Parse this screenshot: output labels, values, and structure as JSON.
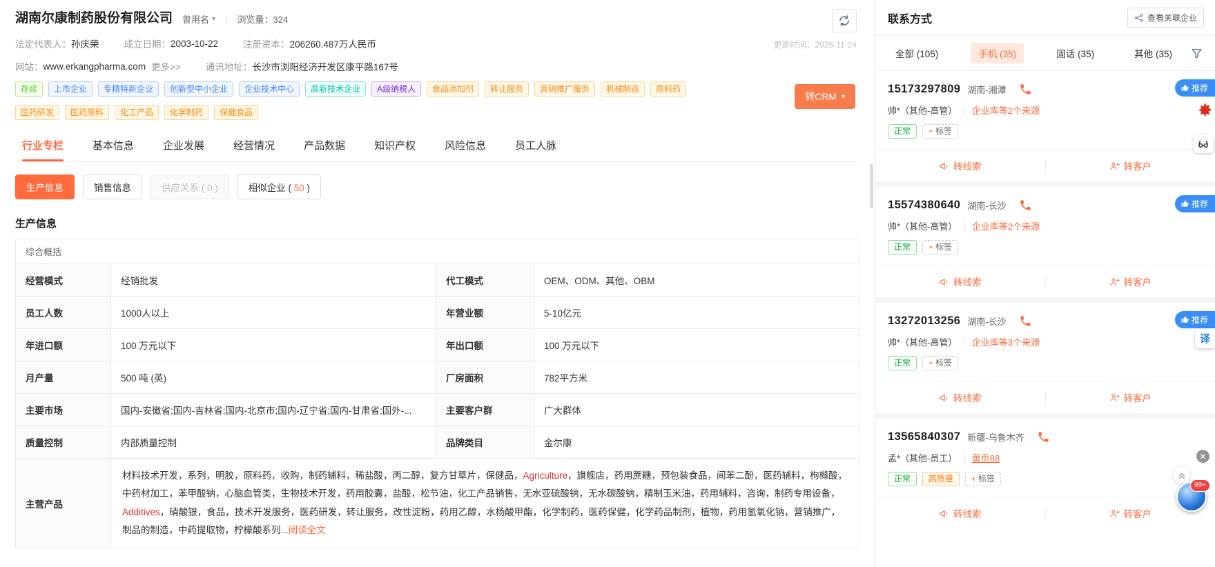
{
  "colors": {
    "accent_orange": "#ff6a3c",
    "crm_button_orange": "#f87c4b",
    "badge_blue": "#3a8ff7",
    "tag_green": "#52c41a",
    "tag_blue": "#3d7fff",
    "tag_teal": "#00b8a9",
    "tag_purple": "#722ed1",
    "tag_orange": "#fa8c16",
    "status_green": "#00b42a",
    "quality_orange": "#ff7d00",
    "highlight_red": "#e03131"
  },
  "header": {
    "company_name": "湖南尔康制药股份有限公司",
    "former_name_label": "曾用名",
    "views_label": "浏览量：",
    "views_count": "324",
    "update_time": "更新时间：2025-11-24",
    "fields": [
      {
        "label": "法定代表人：",
        "value": "孙庆荣"
      },
      {
        "label": "成立日期：",
        "value": "2003-10-22"
      },
      {
        "label": "注册资本：",
        "value": "206260.487万人民币"
      }
    ],
    "website_label": "网站：",
    "website_value": "www.erkangpharma.com",
    "more_link": "更多>>",
    "address_label": "通讯地址：",
    "address_value": "长沙市浏阳经济开发区康平路167号",
    "crm_label": "转CRM",
    "tags_row1": [
      {
        "text": "存续",
        "type": "green"
      },
      {
        "text": "上市企业",
        "type": "blue"
      },
      {
        "text": "专精特新企业",
        "type": "blue"
      },
      {
        "text": "创新型中小企业",
        "type": "blue"
      },
      {
        "text": "企业技术中心",
        "type": "blue"
      },
      {
        "text": "高新技术企业",
        "type": "teal"
      },
      {
        "text": "A级纳税人",
        "type": "purple"
      },
      {
        "text": "食品添加剂",
        "type": "orange"
      },
      {
        "text": "转让服务",
        "type": "orange"
      },
      {
        "text": "营销推广服务",
        "type": "orange"
      },
      {
        "text": "机械制造",
        "type": "orange"
      },
      {
        "text": "原料药",
        "type": "orange"
      }
    ],
    "tags_row2": [
      {
        "text": "医药研发",
        "type": "orange"
      },
      {
        "text": "医药原料",
        "type": "orange"
      },
      {
        "text": "化工产品",
        "type": "orange"
      },
      {
        "text": "化学制药",
        "type": "orange"
      },
      {
        "text": "保健食品",
        "type": "orange"
      }
    ]
  },
  "tabs": {
    "items": [
      "行业专栏",
      "基本信息",
      "企业发展",
      "经营情况",
      "产品数据",
      "知识产权",
      "风险信息",
      "员工人脉"
    ],
    "active_index": 0
  },
  "subtabs": [
    {
      "label": "生产信息",
      "state": "active"
    },
    {
      "label": "销售信息",
      "state": "normal"
    },
    {
      "label": "供应关系 ( 0 )",
      "state": "disabled"
    },
    {
      "prefix": "相似企业 ( ",
      "count": "50",
      "suffix": " )",
      "state": "normal"
    }
  ],
  "production": {
    "section_title": "生产信息",
    "table_header": "综合概括",
    "rows": [
      [
        {
          "label": "经营模式",
          "value": "经销批发"
        },
        {
          "label": "代工模式",
          "value": "OEM、ODM、其他、OBM"
        }
      ],
      [
        {
          "label": "员工人数",
          "value": "1000人以上"
        },
        {
          "label": "年营业额",
          "value": "5-10亿元"
        }
      ],
      [
        {
          "label": "年进口额",
          "value": "100 万元以下"
        },
        {
          "label": "年出口额",
          "value": "100 万元以下"
        }
      ],
      [
        {
          "label": "月产量",
          "value": "500 吨 (英)"
        },
        {
          "label": "厂房面积",
          "value": "782平方米"
        }
      ],
      [
        {
          "label": "主要市场",
          "value": "国内-安徽省;国内-吉林省;国内-北京市;国内-辽宁省;国内-甘肃省;国外-..."
        },
        {
          "label": "主要客户群",
          "value": "广大群体"
        }
      ],
      [
        {
          "label": "质量控制",
          "value": "内部质量控制"
        },
        {
          "label": "品牌类目",
          "value": "金尔康"
        }
      ]
    ],
    "main_products": {
      "label": "主营产品",
      "segments": [
        {
          "text": "材料技术开发，系列，明胶，原料药，收购，制药辅料，稀盐酸，丙二醇，复方甘草片，保健品，"
        },
        {
          "text": "Agriculture",
          "highlight": true
        },
        {
          "text": "，旗舰店，药用蔗糖，预包装食品，间苯二酚，医药辅料，枸橼酸，中药材加工，苯甲酸钠，心脑血管类，生物技术开发，药用胶囊，盐酸，松节油，化工产品销售，无水亚硫酸钠，无水碳酸钠，精制玉米油，药用辅料，咨询，制药专用设备，"
        },
        {
          "text": "Additives",
          "highlight": true
        },
        {
          "text": "，硝酸银，食品，技术开发服务，医药研发，转让服务，改性淀粉，药用乙醇，水杨酸甲酯，化学制药，医药保健，化学药品制剂，植物，药用氢氧化钠，营销推广，制品的制造，中药提取物，柠檬酸系列..."
        }
      ],
      "read_more": "阅读全文"
    }
  },
  "contacts": {
    "title": "联系方式",
    "related_button_label": "查看关联企业",
    "filters": [
      {
        "text": "全部 (105)",
        "active": false
      },
      {
        "text": "手机 (35)",
        "active": true
      },
      {
        "text": "固话 (35)",
        "active": false
      },
      {
        "text": "其他 (35)",
        "active": false
      }
    ],
    "badge_label": "推荐",
    "add_tag_label": "标签",
    "actions": {
      "to_lead": "转线索",
      "to_customer": "转客户"
    },
    "cards": [
      {
        "phone": "15173297809",
        "location": "湖南-湘潭",
        "person": "帅*（其他-高管）",
        "source": "企业库等2个来源",
        "source_underline": false,
        "recommended": true,
        "tags": [
          {
            "text": "正常",
            "type": "green"
          }
        ]
      },
      {
        "phone": "15574380640",
        "location": "湖南-长沙",
        "person": "帅*（其他-高管）",
        "source": "企业库等2个来源",
        "source_underline": false,
        "recommended": true,
        "tags": [
          {
            "text": "正常",
            "type": "green"
          }
        ]
      },
      {
        "phone": "13272013256",
        "location": "湖南-长沙",
        "person": "帅*（其他-高管）",
        "source": "企业库等3个来源",
        "source_underline": false,
        "recommended": true,
        "tags": [
          {
            "text": "正常",
            "type": "green"
          }
        ]
      },
      {
        "phone": "13565840307",
        "location": "新疆-乌鲁木齐",
        "person": "孟*（其他-员工）",
        "source": "黄页88",
        "source_underline": true,
        "recommended": false,
        "tags": [
          {
            "text": "正常",
            "type": "green"
          },
          {
            "text": "高质量",
            "type": "orange"
          }
        ]
      }
    ]
  },
  "floating": {
    "translate_label": "译",
    "badge_count": "99+"
  }
}
